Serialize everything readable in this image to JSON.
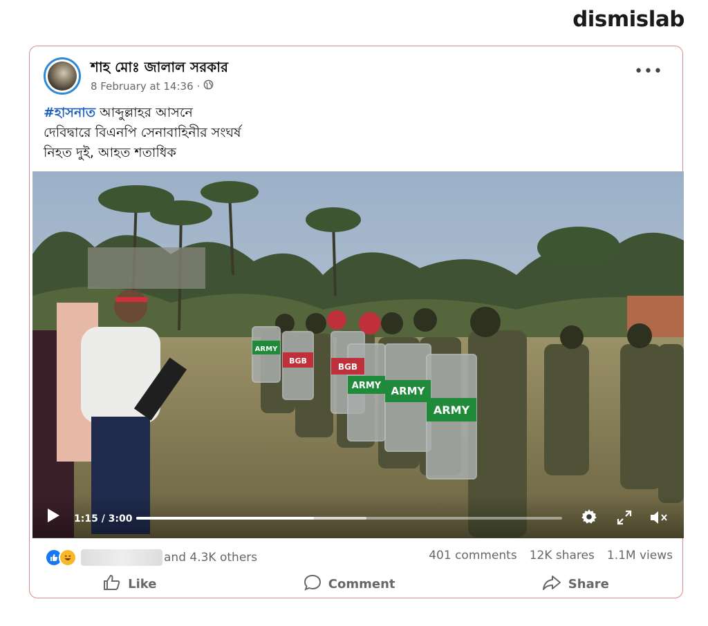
{
  "brand": "dismislab",
  "post": {
    "author": "শাহ মোঃ জালাল সরকার",
    "date": "8 February at 14:36",
    "separator": "·",
    "more_label": "•••",
    "hashtag": "#হাসনাত",
    "line1_rest": " আব্দুল্লাহর আসনে",
    "line2": "দেবিদ্বারে বিএনপি সেনাবাহিনীর সংঘর্ষ",
    "line3": "নিহত দুই, আহত শতাধিক"
  },
  "video": {
    "time": "1:15 / 3:00",
    "progress": 0.417,
    "buffered": 0.54,
    "shield_labels": [
      "ARMY",
      "BGB",
      "BGB",
      "ARMY",
      "ARMY",
      "ARMY"
    ]
  },
  "engagement": {
    "reactions_text": "and 4.3K others",
    "comments": "401 comments",
    "shares": "12K shares",
    "views": "1.1M views"
  },
  "actions": {
    "like": "Like",
    "comment": "Comment",
    "share": "Share"
  },
  "colors": {
    "link": "#2060c0",
    "avatar_ring": "#2d88d8",
    "card_border": "#d98a8a",
    "army_green": "#1f8a3a",
    "bgb_red": "#c0303a"
  }
}
